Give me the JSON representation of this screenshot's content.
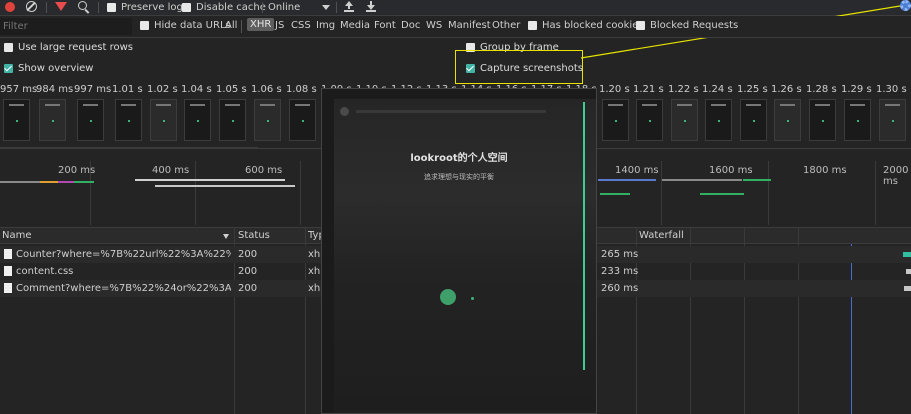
{
  "toolbar": {
    "preserve_log": "Preserve log",
    "disable_cache": "Disable cache",
    "throttle": "Online"
  },
  "filterbar": {
    "placeholder": "Filter",
    "hide_data_urls": "Hide data URLs",
    "types": [
      "All",
      "XHR",
      "JS",
      "CSS",
      "Img",
      "Media",
      "Font",
      "Doc",
      "WS",
      "Manifest",
      "Other"
    ],
    "selected_type": "XHR",
    "has_blocked_cookies": "Has blocked cookies",
    "blocked_requests": "Blocked Requests"
  },
  "options": {
    "large_rows": "Use large request rows",
    "show_overview": "Show overview",
    "group_by_frame": "Group by frame",
    "capture_screenshots": "Capture screenshots"
  },
  "strip_times": [
    "957 ms",
    "984 ms",
    "997 ms",
    "1.01 s",
    "1.02 s",
    "1.04 s",
    "1.05 s",
    "1.06 s",
    "1.08 s",
    "1.09 s",
    "1.10 s",
    "1.12 s",
    "1.13 s",
    "1.14 s",
    "1.16 s",
    "1.17 s",
    "1.18 s",
    "1.20 s",
    "1.21 s",
    "1.22 s",
    "1.24 s",
    "1.25 s",
    "1.26 s",
    "1.28 s",
    "1.29 s",
    "1.30 s"
  ],
  "overview_labels": [
    "200 ms",
    "400 ms",
    "600 ms",
    "1400 ms",
    "1600 ms",
    "1800 ms",
    "2000 ms"
  ],
  "table": {
    "headers": {
      "name": "Name",
      "status": "Status",
      "type": "Typ",
      "waterfall": "Waterfall"
    },
    "rows": [
      {
        "name": "Counter?where=%7B%22url%22%3A%22%2F%2...",
        "status": "200",
        "type": "xhr",
        "time": "265 ms"
      },
      {
        "name": "content.css",
        "status": "200",
        "type": "xhr",
        "time": "233 ms"
      },
      {
        "name": "Comment?where=%7B%22%24or%22%3A%5B%...",
        "status": "200",
        "type": "xhr",
        "time": "260 ms"
      }
    ]
  },
  "popup": {
    "title": "lookroot的个人空间",
    "subtitle": "追求理想与现实的平衡"
  }
}
